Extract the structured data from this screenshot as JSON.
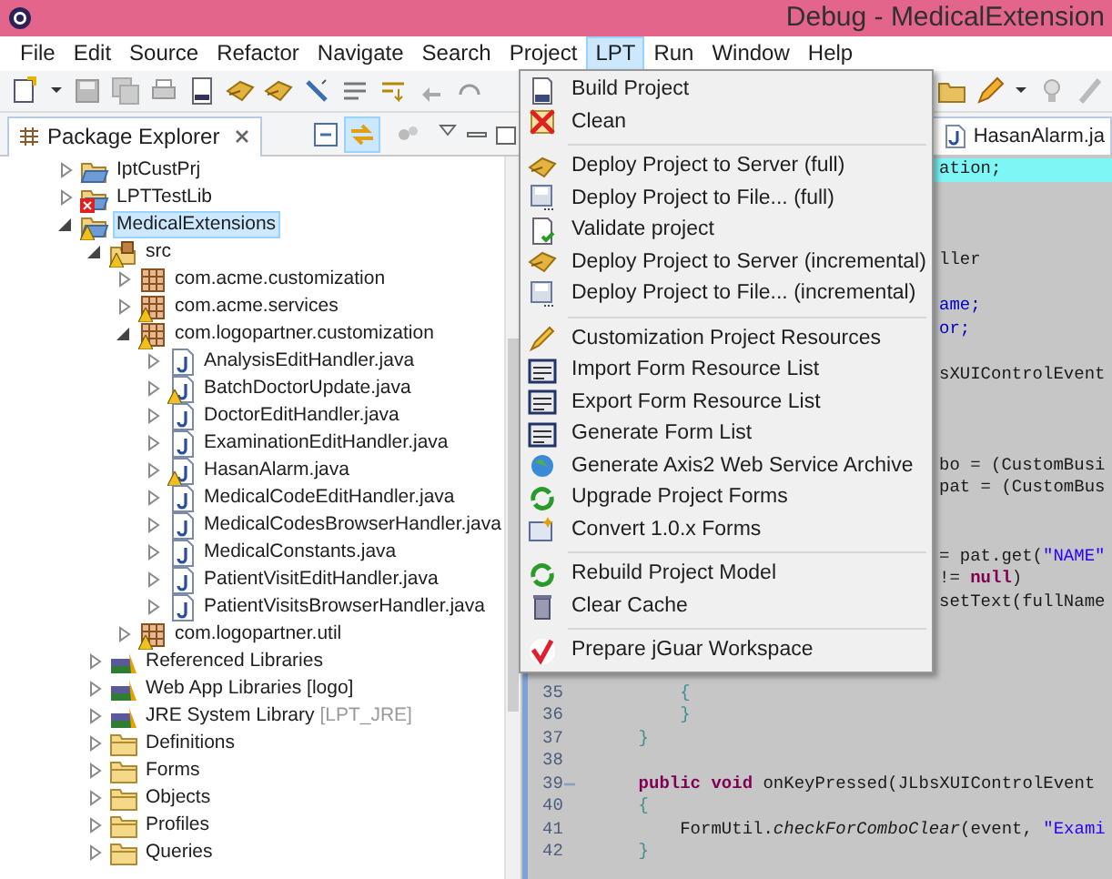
{
  "window": {
    "title": "Debug - MedicalExtension"
  },
  "menu_bar": [
    {
      "label": "File",
      "selected": false
    },
    {
      "label": "Edit",
      "selected": false
    },
    {
      "label": "Source",
      "selected": false
    },
    {
      "label": "Refactor",
      "selected": false
    },
    {
      "label": "Navigate",
      "selected": false
    },
    {
      "label": "Search",
      "selected": false
    },
    {
      "label": "Project",
      "selected": false
    },
    {
      "label": "LPT",
      "selected": true
    },
    {
      "label": "Run",
      "selected": false
    },
    {
      "label": "Window",
      "selected": false
    },
    {
      "label": "Help",
      "selected": false
    }
  ],
  "package_explorer": {
    "tab": "Package Explorer",
    "link_with_editor": true,
    "tree": [
      {
        "label": "IptCustPrj",
        "kind": "project",
        "expanded": false,
        "selected": false
      },
      {
        "label": "LPTTestLib",
        "kind": "project",
        "expanded": false,
        "selected": false,
        "error": true
      },
      {
        "label": "MedicalExtensions",
        "kind": "project",
        "expanded": true,
        "selected": true,
        "warning": true,
        "children": [
          {
            "label": "src",
            "kind": "source-folder",
            "expanded": true,
            "selected": false,
            "warning": true,
            "children": [
              {
                "label": "com.acme.customization",
                "kind": "package",
                "expanded": false,
                "selected": false
              },
              {
                "label": "com.acme.services",
                "kind": "package",
                "expanded": false,
                "selected": false,
                "warning": true
              },
              {
                "label": "com.logopartner.customization",
                "kind": "package",
                "expanded": true,
                "selected": false,
                "warning": true,
                "children": [
                  {
                    "label": "AnalysisEditHandler.java",
                    "kind": "java-file",
                    "expanded": false,
                    "selected": false
                  },
                  {
                    "label": "BatchDoctorUpdate.java",
                    "kind": "java-file",
                    "expanded": false,
                    "selected": false,
                    "warning": true
                  },
                  {
                    "label": "DoctorEditHandler.java",
                    "kind": "java-file",
                    "expanded": false,
                    "selected": false
                  },
                  {
                    "label": "ExaminationEditHandler.java",
                    "kind": "java-file",
                    "expanded": false,
                    "selected": false
                  },
                  {
                    "label": "HasanAlarm.java",
                    "kind": "java-file",
                    "expanded": false,
                    "selected": false,
                    "warning": true
                  },
                  {
                    "label": "MedicalCodeEditHandler.java",
                    "kind": "java-file",
                    "expanded": false,
                    "selected": false
                  },
                  {
                    "label": "MedicalCodesBrowserHandler.java",
                    "kind": "java-file",
                    "expanded": false,
                    "selected": false
                  },
                  {
                    "label": "MedicalConstants.java",
                    "kind": "java-file",
                    "expanded": false,
                    "selected": false
                  },
                  {
                    "label": "PatientVisitEditHandler.java",
                    "kind": "java-file",
                    "expanded": false,
                    "selected": false
                  },
                  {
                    "label": "PatientVisitsBrowserHandler.java",
                    "kind": "java-file",
                    "expanded": false,
                    "selected": false
                  }
                ]
              },
              {
                "label": "com.logopartner.util",
                "kind": "package",
                "expanded": false,
                "selected": false,
                "warning": true
              }
            ]
          },
          {
            "label": "Referenced Libraries",
            "kind": "library",
            "expanded": false,
            "selected": false
          },
          {
            "label": "Web App Libraries [logo]",
            "kind": "library",
            "expanded": false,
            "selected": false
          },
          {
            "label": "JRE System Library",
            "decoration": "[LPT_JRE]",
            "kind": "library",
            "expanded": false,
            "selected": false
          },
          {
            "label": "Definitions",
            "kind": "folder",
            "expanded": false,
            "selected": false
          },
          {
            "label": "Forms",
            "kind": "folder",
            "expanded": false,
            "selected": false
          },
          {
            "label": "Objects",
            "kind": "folder",
            "expanded": false,
            "selected": false
          },
          {
            "label": "Profiles",
            "kind": "folder",
            "expanded": false,
            "selected": false
          },
          {
            "label": "Queries",
            "kind": "folder",
            "expanded": false,
            "selected": false
          }
        ]
      }
    ]
  },
  "editor": {
    "tabs": [
      {
        "label": "HasanAlarm.ja",
        "selected": true
      }
    ],
    "lines": [
      {
        "highlight": true,
        "segments": [
          {
            "text": "ation;",
            "kind": "plain"
          }
        ]
      },
      {
        "highlight": false,
        "segments": [
          {
            "text": "ller",
            "kind": "plain"
          }
        ]
      },
      {
        "highlight": false,
        "segments": [
          {
            "text": "ame;",
            "kind": "field"
          }
        ]
      },
      {
        "highlight": false,
        "segments": [
          {
            "text": "or;",
            "kind": "field"
          }
        ]
      },
      {
        "highlight": false,
        "segments": [
          {
            "text": "sXUIControlEvent",
            "kind": "plain"
          }
        ]
      },
      {
        "highlight": false,
        "segments": [
          {
            "text": "bo = (CustomBusi",
            "kind": "plain"
          }
        ]
      },
      {
        "highlight": false,
        "segments": [
          {
            "text": "pat = (CustomBus",
            "kind": "plain"
          }
        ]
      },
      {
        "highlight": false,
        "segments": [
          {
            "text": "= pat.get(",
            "kind": "plain"
          },
          {
            "text": "\"NAME\"",
            "kind": "string"
          }
        ]
      },
      {
        "highlight": false,
        "segments": [
          {
            "text": "!= ",
            "kind": "plain"
          },
          {
            "text": "null",
            "kind": "keyword"
          },
          {
            "text": ")",
            "kind": "plain"
          }
        ]
      },
      {
        "highlight": false,
        "segments": [
          {
            "text": "setText(fullName",
            "kind": "plain"
          }
        ]
      },
      {
        "number": "35",
        "segments": [
          {
            "text": "        {",
            "kind": "brace"
          }
        ]
      },
      {
        "number": "36",
        "segments": [
          {
            "text": "        }",
            "kind": "brace"
          }
        ]
      },
      {
        "number": "37",
        "segments": [
          {
            "text": "    }",
            "kind": "brace"
          }
        ]
      },
      {
        "number": "38"
      },
      {
        "number": "39",
        "folded": false,
        "segments": [
          {
            "text": "    public",
            "kind": "keyword"
          },
          {
            "text": " void",
            "kind": "keyword"
          },
          {
            "text": " onKeyPressed(JLbsXUIControlEvent",
            "kind": "plain"
          }
        ]
      },
      {
        "number": "40",
        "segments": [
          {
            "text": "    {",
            "kind": "brace"
          }
        ]
      },
      {
        "number": "41",
        "segments": [
          {
            "text": "        FormUtil.",
            "kind": "plain"
          },
          {
            "text": "checkForComboClear",
            "kind": "static"
          },
          {
            "text": "(event, ",
            "kind": "plain"
          },
          {
            "text": "\"Exami",
            "kind": "string"
          }
        ]
      },
      {
        "number": "42",
        "segments": [
          {
            "text": "    }",
            "kind": "brace"
          }
        ]
      }
    ]
  },
  "lpt_menu": [
    {
      "label": "Build Project",
      "separator_before": false
    },
    {
      "label": "Clean",
      "separator_before": false
    },
    {
      "label": "Deploy Project to Server (full)",
      "separator_before": true
    },
    {
      "label": "Deploy Project to File... (full)",
      "separator_before": false
    },
    {
      "label": "Validate project",
      "separator_before": false
    },
    {
      "label": "Deploy Project to Server (incremental)",
      "separator_before": false
    },
    {
      "label": "Deploy Project to File... (incremental)",
      "separator_before": false
    },
    {
      "label": "Customization Project Resources",
      "separator_before": true
    },
    {
      "label": "Import Form Resource List",
      "separator_before": false
    },
    {
      "label": "Export Form Resource List",
      "separator_before": false
    },
    {
      "label": "Generate Form List",
      "separator_before": false
    },
    {
      "label": "Generate Axis2 Web Service Archive",
      "separator_before": false
    },
    {
      "label": "Upgrade Project Forms",
      "separator_before": false
    },
    {
      "label": "Convert 1.0.x Forms",
      "separator_before": false
    },
    {
      "label": "Rebuild Project Model",
      "separator_before": true
    },
    {
      "label": "Clear Cache",
      "separator_before": false
    },
    {
      "label": "Prepare jGuar Workspace",
      "separator_before": true
    }
  ]
}
